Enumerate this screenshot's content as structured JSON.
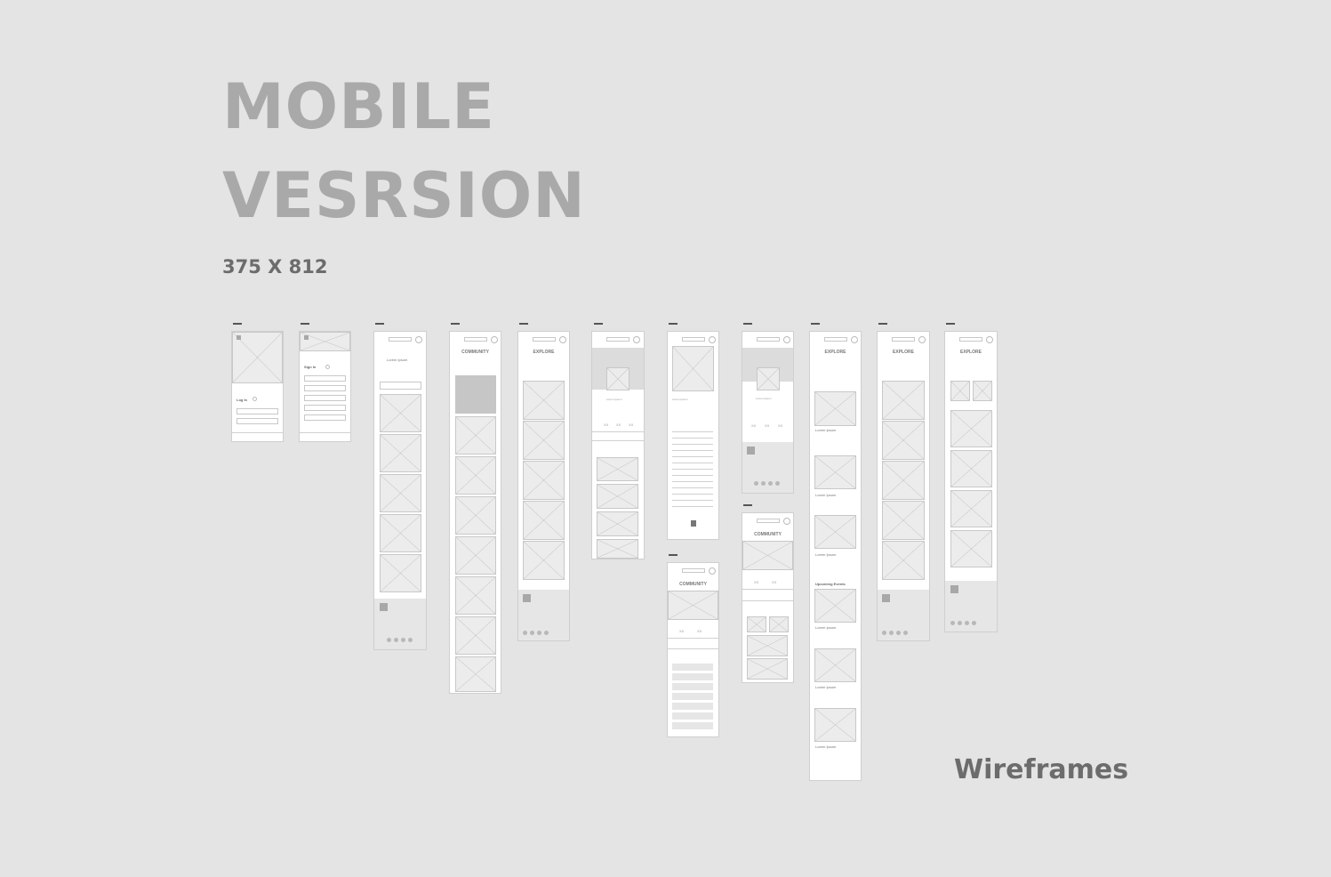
{
  "heading": {
    "line1": "MOBILE",
    "line2": "VESRSION"
  },
  "dimensions": "375 X 812",
  "footer_label": "Wireframes",
  "colors": {
    "background": "#e4e4e4",
    "title": "#a9a9a9",
    "text_dark": "#6c6c6c",
    "frame": "#ffffff",
    "placeholder": "#ececec"
  },
  "wireframe_text": {
    "login": "Log In",
    "signup": "Sign In",
    "community": "COMMUNITY",
    "explore": "EXPLORE",
    "lorem": "Lorem Ipsum",
    "upcoming": "Upcoming Events",
    "stat": "XX"
  }
}
